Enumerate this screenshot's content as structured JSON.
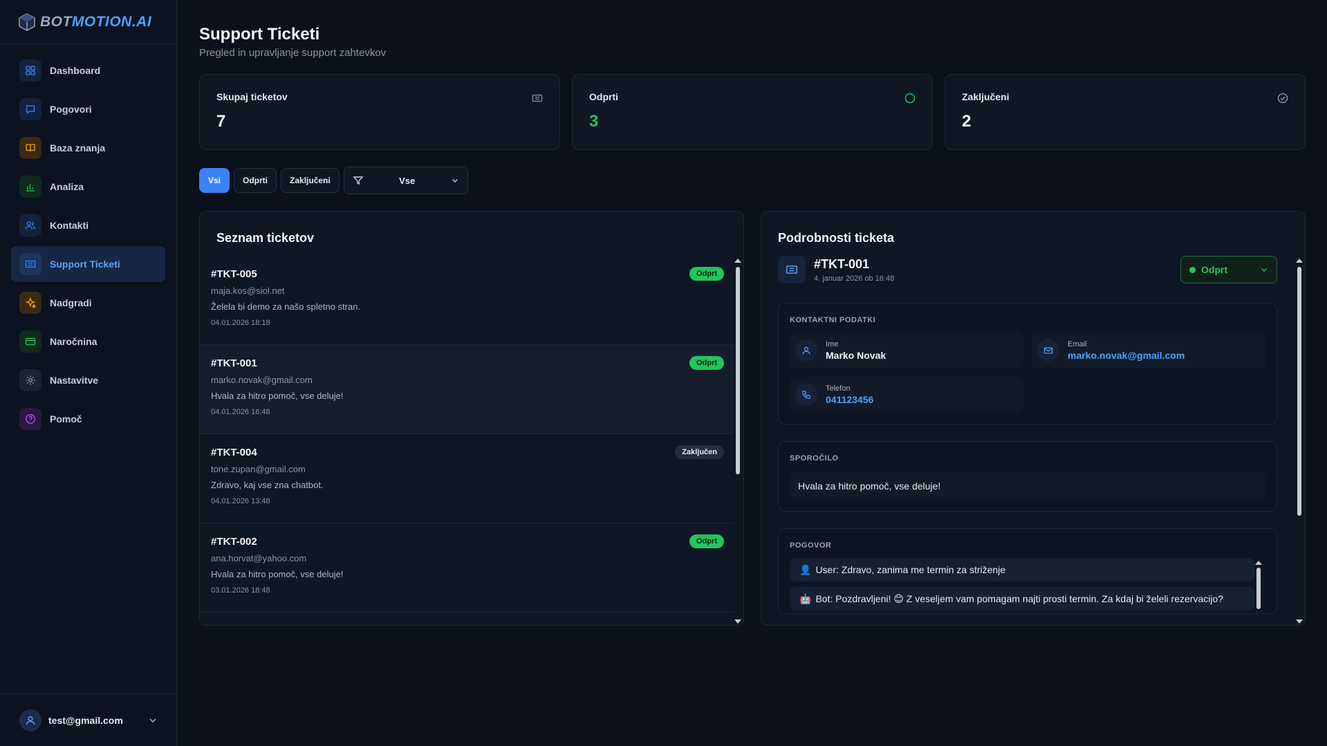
{
  "brand": {
    "part1": "BOT",
    "part2": "MOTION.AI"
  },
  "nav": [
    {
      "label": "Dashboard",
      "icon": "grid-icon",
      "color": "#3b82f6",
      "bg": "#13233f"
    },
    {
      "label": "Pogovori",
      "icon": "chat-icon",
      "color": "#3b82f6",
      "bg": "#13233f"
    },
    {
      "label": "Baza znanja",
      "icon": "book-icon",
      "color": "#f59e0b",
      "bg": "#3a2a10"
    },
    {
      "label": "Analiza",
      "icon": "bar-chart-icon",
      "color": "#22c55e",
      "bg": "#102a1e"
    },
    {
      "label": "Kontakti",
      "icon": "users-icon",
      "color": "#3b82f6",
      "bg": "#13233f"
    },
    {
      "label": "Support Ticketi",
      "icon": "ticket-icon",
      "color": "#3b82f6",
      "bg": "#1d3560",
      "active": true
    },
    {
      "label": "Nadgradi",
      "icon": "sparkle-icon",
      "color": "#f59e0b",
      "bg": "#3a2a10"
    },
    {
      "label": "Naročnina",
      "icon": "card-icon",
      "color": "#22c55e",
      "bg": "#102a1e"
    },
    {
      "label": "Nastavitve",
      "icon": "gear-icon",
      "color": "#9aa3b3",
      "bg": "#1b2230"
    },
    {
      "label": "Pomoč",
      "icon": "help-icon",
      "color": "#a855f7",
      "bg": "#2a1840"
    }
  ],
  "user": {
    "email": "test@gmail.com"
  },
  "page": {
    "title": "Support Ticketi",
    "subtitle": "Pregled in upravljanje support zahtevkov"
  },
  "stats": [
    {
      "label": "Skupaj ticketov",
      "value": "7",
      "icon": "ticket-icon"
    },
    {
      "label": "Odprti",
      "value": "3",
      "icon": "circle-icon"
    },
    {
      "label": "Zaključeni",
      "value": "2",
      "icon": "check-circle-icon"
    }
  ],
  "filters": {
    "all": "Vsi",
    "open": "Odprti",
    "closed": "Zaključeni",
    "select_value": "Vse"
  },
  "list": {
    "title": "Seznam ticketov",
    "tickets": [
      {
        "id": "#TKT-005",
        "email": "maja.kos@siol.net",
        "message": "Želela bi demo za našo spletno stran.",
        "date": "04.01.2026 18:18",
        "status": "Odprt",
        "open": true
      },
      {
        "id": "#TKT-001",
        "email": "marko.novak@gmail.com",
        "message": "Hvala za hitro pomoč, vse deluje!",
        "date": "04.01.2026 16:48",
        "status": "Odprt",
        "open": true,
        "selected": true
      },
      {
        "id": "#TKT-004",
        "email": "tone.zupan@gmail.com",
        "message": "Zdravo, kaj vse zna chatbot.",
        "date": "04.01.2026 13:48",
        "status": "Zaključen",
        "open": false
      },
      {
        "id": "#TKT-002",
        "email": "ana.horvat@yahoo.com",
        "message": "Hvala za hitro pomoč, vse deluje!",
        "date": "03.01.2026 18:48",
        "status": "Odprt",
        "open": true
      }
    ]
  },
  "detail": {
    "title": "Podrobnosti ticketa",
    "id": "#TKT-001",
    "date": "4. januar 2026 ob 16:48",
    "status": "Odprt",
    "contact_label": "KONTAKTNI PODATKI",
    "name_label": "Ime",
    "name": "Marko Novak",
    "email_label": "Email",
    "email": "marko.novak@gmail.com",
    "phone_label": "Telefon",
    "phone": "041123456",
    "message_label": "SPOROČILO",
    "message": "Hvala za hitro pomoč, vse deluje!",
    "conversation_label": "POGOVOR",
    "conversation": [
      {
        "emoji": "👤",
        "text": "User: Zdravo, zanima me termin za striženje"
      },
      {
        "emoji": "🤖",
        "text": "Bot: Pozdravljeni! 😊 Z veseljem vam pomagam najti prosti termin. Za kdaj bi želeli rezervacijo?"
      }
    ]
  },
  "colors": {
    "accent": "#3b82f6",
    "success": "#22c55e",
    "bg": "#0b101b",
    "card": "#0f1624"
  }
}
